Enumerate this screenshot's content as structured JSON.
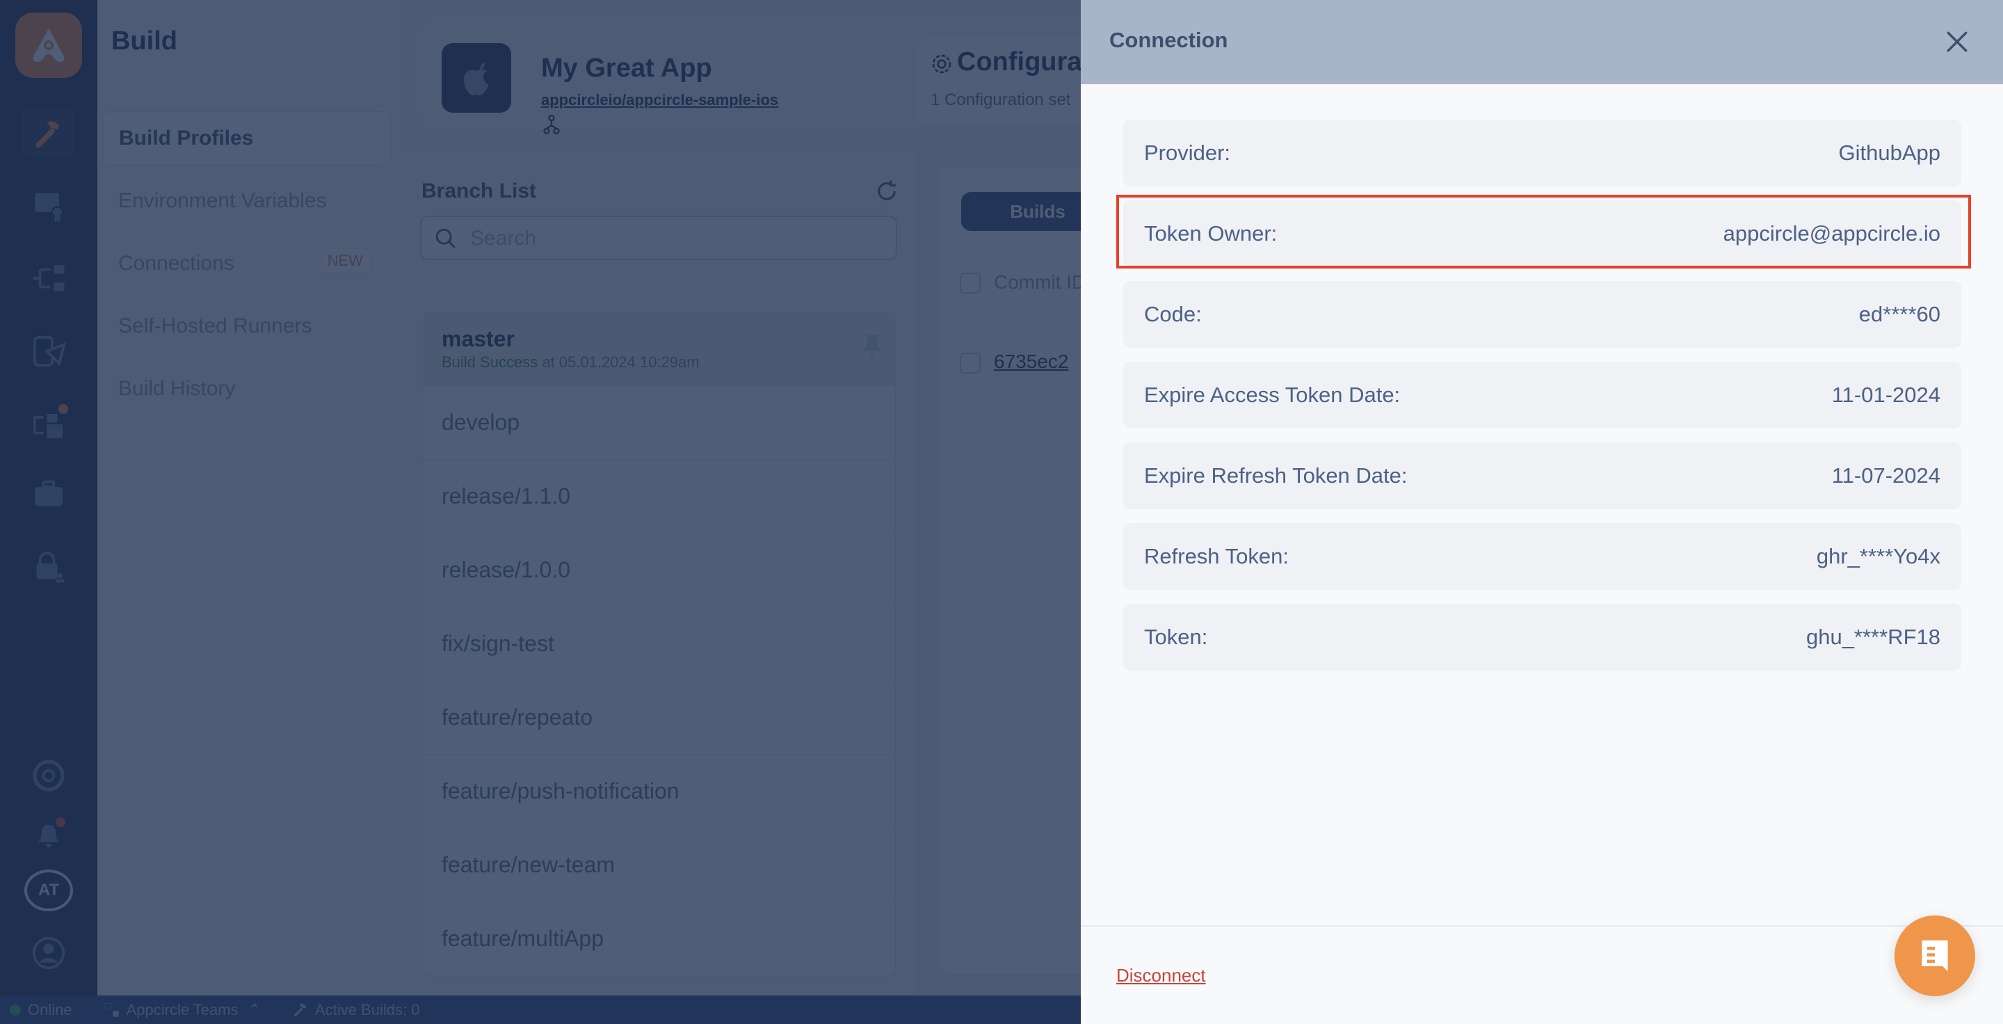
{
  "rail": {
    "items": [
      {
        "name": "build",
        "icon": "hammer-icon",
        "active": true
      },
      {
        "name": "signing-identities",
        "icon": "certificate-icon"
      },
      {
        "name": "distribution",
        "icon": "distribution-icon"
      },
      {
        "name": "testing-distribution",
        "icon": "testing-icon"
      },
      {
        "name": "publish",
        "icon": "publish-icon",
        "badge": true
      },
      {
        "name": "enterprise-store",
        "icon": "briefcase-icon"
      },
      {
        "name": "account",
        "icon": "lock-user-icon"
      }
    ],
    "bottom": {
      "support_icon": "support-icon",
      "notifications_icon": "bell-icon",
      "org_initials": "AT",
      "profile_icon": "user-icon"
    }
  },
  "subnav": {
    "title": "Build",
    "items": [
      {
        "label": "Build Profiles",
        "active": true
      },
      {
        "label": "Environment Variables"
      },
      {
        "label": "Connections",
        "badge": "NEW"
      },
      {
        "label": "Self-Hosted Runners"
      },
      {
        "label": "Build History"
      }
    ]
  },
  "app": {
    "name": "My Great App",
    "repo": "appcircleio/appcircle-sample-ios",
    "config_title": "Configura",
    "config_subtitle": "1 Configuration set"
  },
  "branches": {
    "title": "Branch List",
    "search_placeholder": "Search",
    "items": [
      {
        "name": "master",
        "status": "Build Success",
        "status_suffix": "at 05.01.2024 10:29am"
      },
      {
        "name": "develop"
      },
      {
        "name": "release/1.1.0"
      },
      {
        "name": "release/1.0.0"
      },
      {
        "name": "fix/sign-test"
      },
      {
        "name": "feature/repeato"
      },
      {
        "name": "feature/push-notification"
      },
      {
        "name": "feature/new-team"
      },
      {
        "name": "feature/multiApp"
      }
    ]
  },
  "builds": {
    "tab_label": "Builds",
    "column_commit": "Commit ID",
    "commit_value": "6735ec2"
  },
  "statusbar": {
    "online": "Online",
    "team": "Appcircle Teams",
    "active_builds": "Active Builds: 0"
  },
  "drawer": {
    "title": "Connection",
    "fields": [
      {
        "label": "Provider:",
        "value": "GithubApp"
      },
      {
        "label": "Token Owner:",
        "value": "appcircle@appcircle.io",
        "highlighted": true
      },
      {
        "label": "Code:",
        "value": "ed****60"
      },
      {
        "label": "Expire Access Token Date:",
        "value": "11-01-2024"
      },
      {
        "label": "Expire Refresh Token Date:",
        "value": "11-07-2024"
      },
      {
        "label": "Refresh Token:",
        "value": "ghr_****Yo4x"
      },
      {
        "label": "Token:",
        "value": "ghu_****RF18"
      }
    ],
    "disconnect_label": "Disconnect"
  },
  "colors": {
    "highlight": "#e8412b",
    "brand_orange": "#f0964a",
    "danger": "#c8443c"
  }
}
